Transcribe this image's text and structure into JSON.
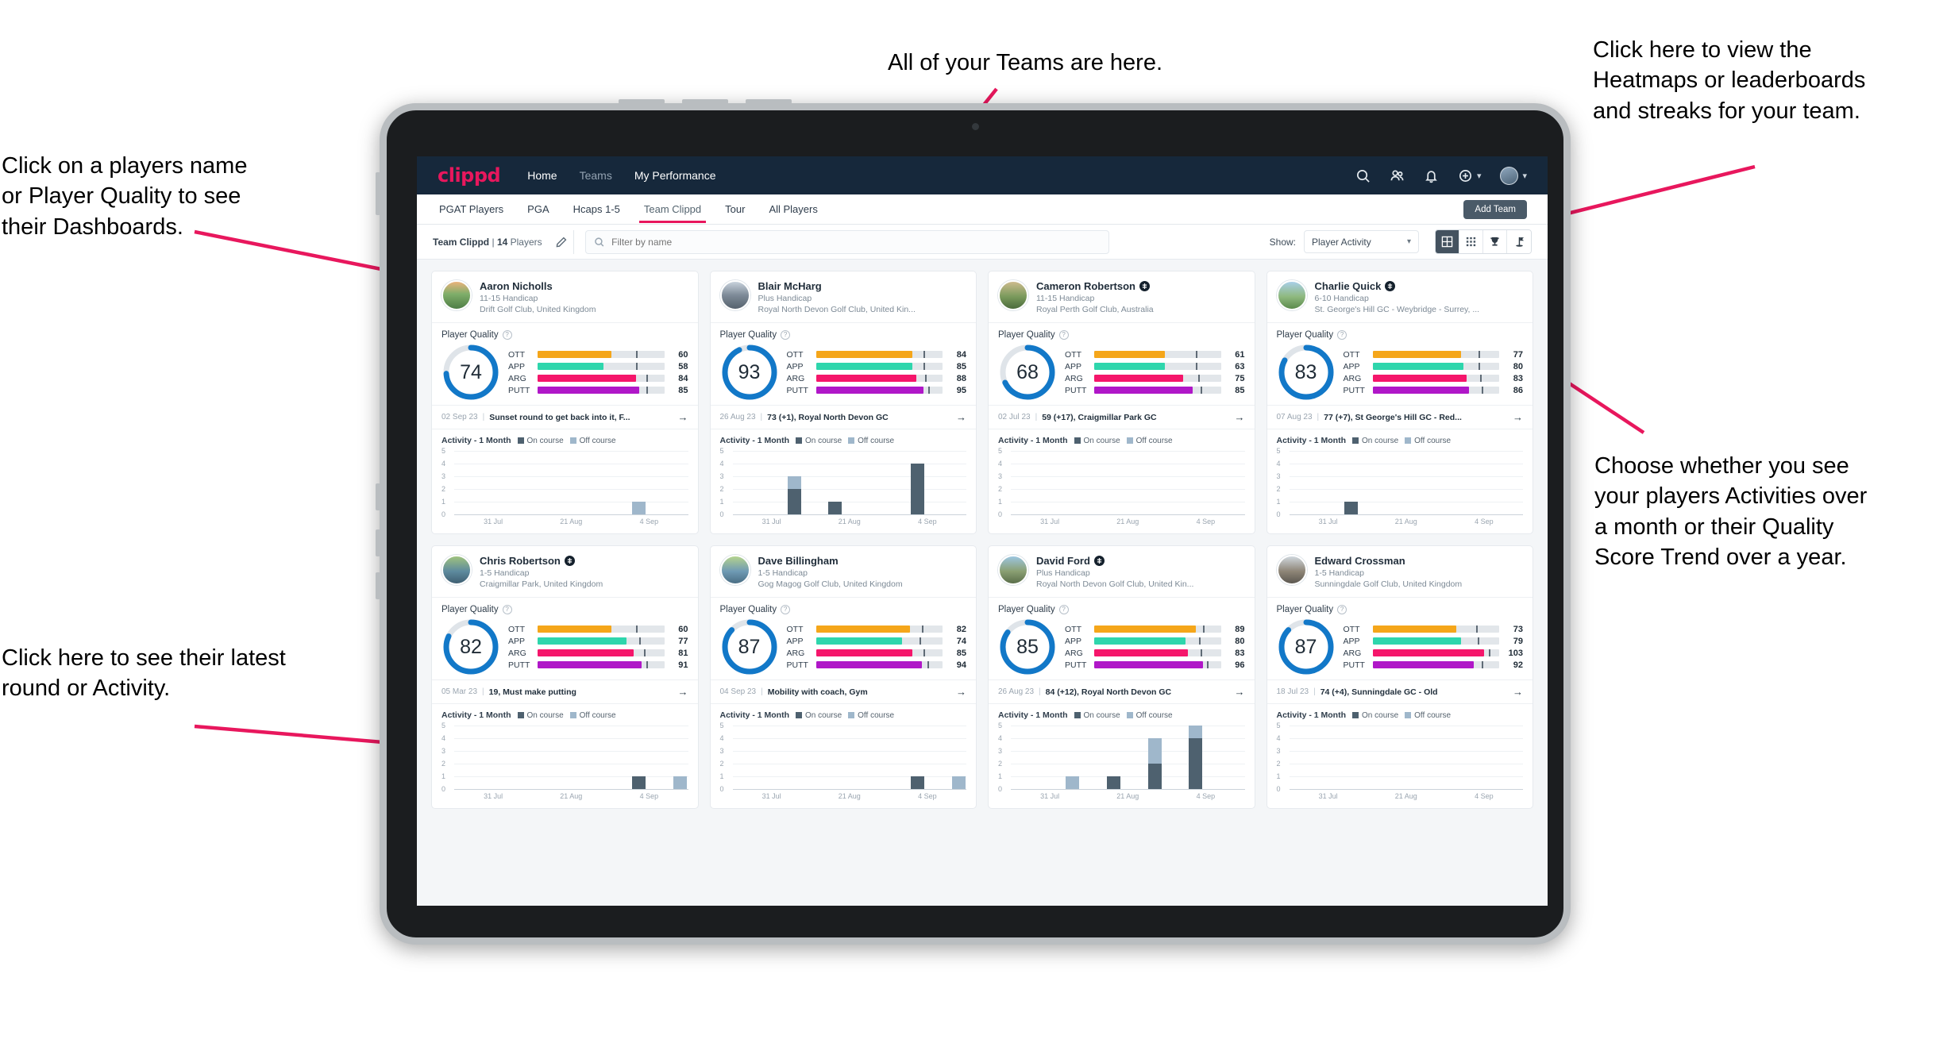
{
  "annotations": [
    {
      "id": "players-name",
      "text": "Click on a players name\nor Player Quality to see\ntheir Dashboards."
    },
    {
      "id": "teams",
      "text": "All of your Teams are here."
    },
    {
      "id": "heatmaps",
      "text": "Click here to view the\nHeatmaps or leaderboards\nand streaks for your team."
    },
    {
      "id": "show-toggle",
      "text": "Choose whether you see\nyour players Activities over\na month or their Quality\nScore Trend over a year."
    },
    {
      "id": "latest-round",
      "text": "Click here to see their latest\nround or Activity."
    }
  ],
  "colors": {
    "brand": "#e8175d",
    "appbar": "#16283b",
    "ring": "#1278c8",
    "ott": "#f5a61a",
    "app": "#2ed6ac",
    "arg": "#f5166b",
    "putt": "#b017c8",
    "on_course": "#4e616f",
    "off_course": "#9fb7cb"
  },
  "appbar": {
    "logo": "clippd",
    "nav": [
      {
        "label": "Home",
        "dim": false
      },
      {
        "label": "Teams",
        "dim": true
      },
      {
        "label": "My Performance",
        "dim": false
      }
    ],
    "icons": [
      "search-icon",
      "people-icon",
      "bell-icon",
      "plus-circle-icon",
      "avatar"
    ]
  },
  "tabs": {
    "items": [
      {
        "label": "PGAT Players",
        "active": false
      },
      {
        "label": "PGA",
        "active": false
      },
      {
        "label": "Hcaps 1-5",
        "active": false
      },
      {
        "label": "Team Clippd",
        "active": true
      },
      {
        "label": "Tour",
        "active": false
      },
      {
        "label": "All Players",
        "active": false
      }
    ],
    "add_team_label": "Add Team"
  },
  "toolbar": {
    "team_name": "Team Clippd",
    "separator": "|",
    "player_count": "14",
    "players_word": "Players",
    "edit_icon": "pencil-icon",
    "search_placeholder": "Filter by name",
    "search_value": "",
    "show_label": "Show:",
    "show_selected": "Player Activity",
    "show_options": [
      "Player Activity",
      "Quality Score Trend"
    ],
    "views": [
      {
        "name": "grid-view",
        "active": true
      },
      {
        "name": "dense-grid-view",
        "active": false
      },
      {
        "name": "trophy-view",
        "active": false
      },
      {
        "name": "flag-view",
        "active": false
      }
    ]
  },
  "card_labels": {
    "quality_title": "Player Quality",
    "activity_title": "Activity - 1 Month",
    "legend_on": "On course",
    "legend_off": "Off course",
    "metrics": [
      "OTT",
      "APP",
      "ARG",
      "PUTT"
    ],
    "y_ticks": [
      "5",
      "4",
      "3",
      "2",
      "1",
      "0"
    ],
    "x_ticks": [
      "31 Jul",
      "21 Aug",
      "4 Sep"
    ]
  },
  "players": [
    {
      "name": "Aaron Nicholls",
      "verified": false,
      "handicap": "11-15 Handicap",
      "club": "Drift Golf Club, United Kingdom",
      "quality": 74,
      "metrics": [
        {
          "label": "OTT",
          "value": 60,
          "fill": 58,
          "tick": 78
        },
        {
          "label": "APP",
          "value": 58,
          "fill": 52,
          "tick": 78
        },
        {
          "label": "ARG",
          "value": 84,
          "fill": 78,
          "tick": 86
        },
        {
          "label": "PUTT",
          "value": 85,
          "fill": 80,
          "tick": 86
        }
      ],
      "round": {
        "date": "02 Sep 23",
        "text": "Sunset round to get back into it, F..."
      },
      "activity": [
        {
          "on": 0,
          "off": 0
        },
        {
          "on": 0,
          "off": 0
        },
        {
          "on": 0,
          "off": 0
        },
        {
          "on": 0,
          "off": 0
        },
        {
          "on": 0,
          "off": 1
        },
        {
          "on": 0,
          "off": 0
        }
      ]
    },
    {
      "name": "Blair McHarg",
      "verified": false,
      "handicap": "Plus Handicap",
      "club": "Royal North Devon Golf Club, United Kin...",
      "quality": 93,
      "metrics": [
        {
          "label": "OTT",
          "value": 84,
          "fill": 76,
          "tick": 85
        },
        {
          "label": "APP",
          "value": 85,
          "fill": 76,
          "tick": 85
        },
        {
          "label": "ARG",
          "value": 88,
          "fill": 79,
          "tick": 86
        },
        {
          "label": "PUTT",
          "value": 95,
          "fill": 85,
          "tick": 89
        }
      ],
      "round": {
        "date": "26 Aug 23",
        "text": "73 (+1), Royal North Devon GC"
      },
      "activity": [
        {
          "on": 0,
          "off": 0
        },
        {
          "on": 2,
          "off": 1
        },
        {
          "on": 1,
          "off": 0
        },
        {
          "on": 0,
          "off": 0
        },
        {
          "on": 4,
          "off": 0
        },
        {
          "on": 0,
          "off": 0
        }
      ]
    },
    {
      "name": "Cameron Robertson",
      "verified": true,
      "handicap": "11-15 Handicap",
      "club": "Royal Perth Golf Club, Australia",
      "quality": 68,
      "metrics": [
        {
          "label": "OTT",
          "value": 61,
          "fill": 56,
          "tick": 80
        },
        {
          "label": "APP",
          "value": 63,
          "fill": 56,
          "tick": 80
        },
        {
          "label": "ARG",
          "value": 75,
          "fill": 70,
          "tick": 82
        },
        {
          "label": "PUTT",
          "value": 85,
          "fill": 78,
          "tick": 84
        }
      ],
      "round": {
        "date": "02 Jul 23",
        "text": "59 (+17), Craigmillar Park GC"
      },
      "activity": [
        {
          "on": 0,
          "off": 0
        },
        {
          "on": 0,
          "off": 0
        },
        {
          "on": 0,
          "off": 0
        },
        {
          "on": 0,
          "off": 0
        },
        {
          "on": 0,
          "off": 0
        },
        {
          "on": 0,
          "off": 0
        }
      ]
    },
    {
      "name": "Charlie Quick",
      "verified": true,
      "handicap": "6-10 Handicap",
      "club": "St. George's Hill GC - Weybridge - Surrey, ...",
      "quality": 83,
      "metrics": [
        {
          "label": "OTT",
          "value": 77,
          "fill": 70,
          "tick": 84
        },
        {
          "label": "APP",
          "value": 80,
          "fill": 72,
          "tick": 84
        },
        {
          "label": "ARG",
          "value": 83,
          "fill": 74,
          "tick": 85
        },
        {
          "label": "PUTT",
          "value": 86,
          "fill": 76,
          "tick": 86
        }
      ],
      "round": {
        "date": "07 Aug 23",
        "text": "77 (+7), St George's Hill GC - Red..."
      },
      "activity": [
        {
          "on": 0,
          "off": 0
        },
        {
          "on": 1,
          "off": 0
        },
        {
          "on": 0,
          "off": 0
        },
        {
          "on": 0,
          "off": 0
        },
        {
          "on": 0,
          "off": 0
        },
        {
          "on": 0,
          "off": 0
        }
      ]
    },
    {
      "name": "Chris Robertson",
      "verified": true,
      "handicap": "1-5 Handicap",
      "club": "Craigmillar Park, United Kingdom",
      "quality": 82,
      "metrics": [
        {
          "label": "OTT",
          "value": 60,
          "fill": 58,
          "tick": 78
        },
        {
          "label": "APP",
          "value": 77,
          "fill": 70,
          "tick": 80
        },
        {
          "label": "ARG",
          "value": 81,
          "fill": 76,
          "tick": 84
        },
        {
          "label": "PUTT",
          "value": 91,
          "fill": 82,
          "tick": 86
        }
      ],
      "round": {
        "date": "05 Mar 23",
        "text": "19, Must make putting"
      },
      "activity": [
        {
          "on": 0,
          "off": 0
        },
        {
          "on": 0,
          "off": 0
        },
        {
          "on": 0,
          "off": 0
        },
        {
          "on": 0,
          "off": 0
        },
        {
          "on": 1,
          "off": 0
        },
        {
          "on": 0,
          "off": 1
        }
      ]
    },
    {
      "name": "Dave Billingham",
      "verified": false,
      "handicap": "1-5 Handicap",
      "club": "Gog Magog Golf Club, United Kingdom",
      "quality": 87,
      "metrics": [
        {
          "label": "OTT",
          "value": 82,
          "fill": 74,
          "tick": 84
        },
        {
          "label": "APP",
          "value": 74,
          "fill": 68,
          "tick": 82
        },
        {
          "label": "ARG",
          "value": 85,
          "fill": 76,
          "tick": 85
        },
        {
          "label": "PUTT",
          "value": 94,
          "fill": 84,
          "tick": 88
        }
      ],
      "round": {
        "date": "04 Sep 23",
        "text": "Mobility with coach, Gym"
      },
      "activity": [
        {
          "on": 0,
          "off": 0
        },
        {
          "on": 0,
          "off": 0
        },
        {
          "on": 0,
          "off": 0
        },
        {
          "on": 0,
          "off": 0
        },
        {
          "on": 1,
          "off": 0
        },
        {
          "on": 0,
          "off": 1
        }
      ]
    },
    {
      "name": "David Ford",
      "verified": true,
      "handicap": "Plus Handicap",
      "club": "Royal North Devon Golf Club, United Kin...",
      "quality": 85,
      "metrics": [
        {
          "label": "OTT",
          "value": 89,
          "fill": 80,
          "tick": 86
        },
        {
          "label": "APP",
          "value": 80,
          "fill": 72,
          "tick": 83
        },
        {
          "label": "ARG",
          "value": 83,
          "fill": 74,
          "tick": 84
        },
        {
          "label": "PUTT",
          "value": 96,
          "fill": 86,
          "tick": 89
        }
      ],
      "round": {
        "date": "26 Aug 23",
        "text": "84 (+12), Royal North Devon GC"
      },
      "activity": [
        {
          "on": 0,
          "off": 0
        },
        {
          "on": 0,
          "off": 1
        },
        {
          "on": 1,
          "off": 0
        },
        {
          "on": 2,
          "off": 2
        },
        {
          "on": 4,
          "off": 1
        },
        {
          "on": 0,
          "off": 0
        }
      ]
    },
    {
      "name": "Edward Crossman",
      "verified": false,
      "handicap": "1-5 Handicap",
      "club": "Sunningdale Golf Club, United Kingdom",
      "quality": 87,
      "metrics": [
        {
          "label": "OTT",
          "value": 73,
          "fill": 66,
          "tick": 82
        },
        {
          "label": "APP",
          "value": 79,
          "fill": 70,
          "tick": 83
        },
        {
          "label": "ARG",
          "value": 103,
          "fill": 88,
          "tick": 92
        },
        {
          "label": "PUTT",
          "value": 92,
          "fill": 80,
          "tick": 86
        }
      ],
      "round": {
        "date": "18 Jul 23",
        "text": "74 (+4), Sunningdale GC - Old"
      },
      "activity": [
        {
          "on": 0,
          "off": 0
        },
        {
          "on": 0,
          "off": 0
        },
        {
          "on": 0,
          "off": 0
        },
        {
          "on": 0,
          "off": 0
        },
        {
          "on": 0,
          "off": 0
        },
        {
          "on": 0,
          "off": 0
        }
      ]
    }
  ]
}
